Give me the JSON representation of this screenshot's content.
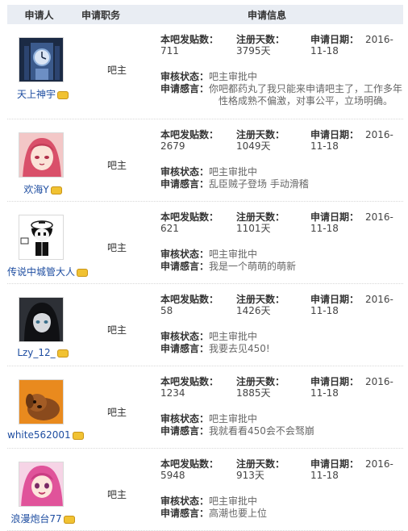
{
  "header": {
    "applicant": "申请人",
    "position": "申请职务",
    "info": "申请信息"
  },
  "labels": {
    "posts": "本吧发贴数：",
    "reg_days": "注册天数：",
    "apply_date": "申请日期：",
    "review_status": "审核状态：",
    "statement": "申请感言："
  },
  "rows": [
    {
      "username": "天上神宇",
      "role": "吧主",
      "posts": "711",
      "reg_days": "3795天",
      "date_a": "2016-",
      "date_b": "11-18",
      "status": "吧主审批中",
      "statement": "你吧都药丸了我只能来申请吧主了，工作多年性格成熟不偏激，对事公平，立场明确。",
      "avatar_icon": "clock-tower-avatar"
    },
    {
      "username": "欢海Y",
      "role": "吧主",
      "posts": "2679",
      "reg_days": "1049天",
      "date_a": "2016-",
      "date_b": "11-18",
      "status": "吧主审批中",
      "statement": "乱臣贼子登场 手动滑稽",
      "avatar_icon": "pink-hair-girl-avatar"
    },
    {
      "username": "传说中城管大人",
      "role": "吧主",
      "posts": "621",
      "reg_days": "1101天",
      "date_a": "2016-",
      "date_b": "11-18",
      "status": "吧主审批中",
      "statement": "我是一个萌萌的萌新",
      "avatar_icon": "chibi-officer-avatar"
    },
    {
      "username": "Lzy_12_",
      "role": "吧主",
      "posts": "58",
      "reg_days": "1426天",
      "date_a": "2016-",
      "date_b": "11-18",
      "status": "吧主审批中",
      "statement": "我要去见450!",
      "avatar_icon": "dark-hair-girl-avatar"
    },
    {
      "username": "white562001",
      "role": "吧主",
      "posts": "1234",
      "reg_days": "1885天",
      "date_a": "2016-",
      "date_b": "11-18",
      "status": "吧主审批中",
      "statement": "我就看看450会不会驽崩",
      "avatar_icon": "brown-plush-dog-avatar"
    },
    {
      "username": "浪漫炮台77",
      "role": "吧主",
      "posts": "5948",
      "reg_days": "913天",
      "date_a": "2016-",
      "date_b": "11-18",
      "status": "吧主审批中",
      "statement": "高潮也要上位",
      "avatar_icon": "pink-hair-anime-avatar"
    }
  ],
  "colors": {
    "header_bg": "#e9edf3",
    "username_link": "#1f4ea1",
    "badge_gold": "#f1c232"
  }
}
